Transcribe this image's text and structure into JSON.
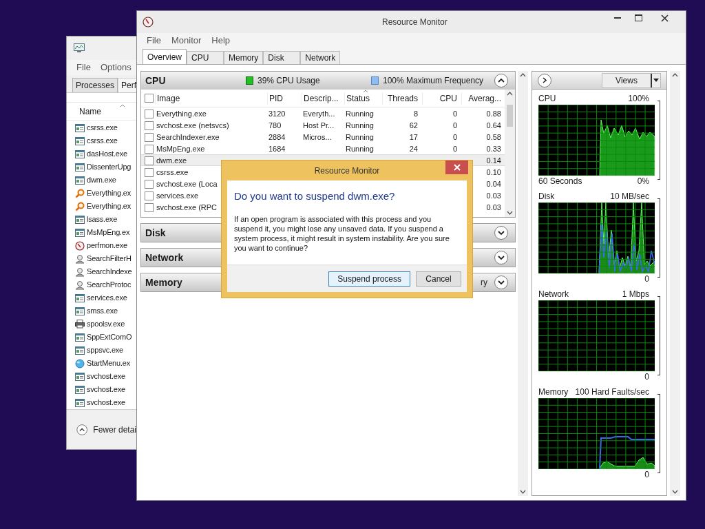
{
  "task_manager": {
    "menu": [
      "File",
      "Options"
    ],
    "tabs": [
      {
        "label": "Processes",
        "selected": true
      },
      {
        "label": "Perf",
        "selected": false
      }
    ],
    "column": "Name",
    "processes": [
      {
        "name": "csrss.exe",
        "kind": "app"
      },
      {
        "name": "csrss.exe",
        "kind": "app"
      },
      {
        "name": "dasHost.exe",
        "kind": "app"
      },
      {
        "name": "DissenterUpg",
        "kind": "app"
      },
      {
        "name": "dwm.exe",
        "kind": "app"
      },
      {
        "name": "Everything.ex",
        "kind": "search"
      },
      {
        "name": "Everything.ex",
        "kind": "search"
      },
      {
        "name": "lsass.exe",
        "kind": "app"
      },
      {
        "name": "MsMpEng.ex",
        "kind": "app"
      },
      {
        "name": "perfmon.exe",
        "kind": "gauge"
      },
      {
        "name": "SearchFilterH",
        "kind": "indexer"
      },
      {
        "name": "SearchIndexe",
        "kind": "indexer"
      },
      {
        "name": "SearchProtoc",
        "kind": "indexer"
      },
      {
        "name": "services.exe",
        "kind": "app"
      },
      {
        "name": "smss.exe",
        "kind": "app"
      },
      {
        "name": "spoolsv.exe",
        "kind": "printer"
      },
      {
        "name": "SppExtComO",
        "kind": "app"
      },
      {
        "name": "sppsvc.exe",
        "kind": "app"
      },
      {
        "name": "StartMenu.ex",
        "kind": "globe"
      },
      {
        "name": "svchost.exe",
        "kind": "app"
      },
      {
        "name": "svchost.exe",
        "kind": "app"
      },
      {
        "name": "svchost.exe",
        "kind": "app"
      }
    ],
    "footer": "Fewer detai"
  },
  "window": {
    "title": "Resource Monitor",
    "menu": [
      "File",
      "Monitor",
      "Help"
    ],
    "tabs": [
      {
        "label": "Overview",
        "selected": true
      },
      {
        "label": "CPU",
        "selected": false
      },
      {
        "label": "Memory",
        "selected": false
      },
      {
        "label": "Disk",
        "selected": false
      },
      {
        "label": "Network",
        "selected": false
      }
    ]
  },
  "cpu_section": {
    "title": "CPU",
    "expanded": true,
    "usage": "39% CPU Usage",
    "frequency": "100% Maximum Frequency",
    "select_all": {
      "checked": false
    },
    "columns": [
      "Image",
      "PID",
      "Descrip...",
      "Status",
      "Threads",
      "CPU",
      "Averag..."
    ],
    "rows": [
      {
        "checked": false,
        "selected": false,
        "image": "Everything.exe",
        "pid": "3120",
        "description": "Everyth...",
        "status": "Running",
        "threads": "8",
        "cpu": "0",
        "average": "0.88"
      },
      {
        "checked": false,
        "selected": false,
        "image": "svchost.exe (netsvcs)",
        "pid": "780",
        "description": "Host Pr...",
        "status": "Running",
        "threads": "62",
        "cpu": "0",
        "average": "0.64"
      },
      {
        "checked": false,
        "selected": false,
        "image": "SearchIndexer.exe",
        "pid": "2884",
        "description": "Micros...",
        "status": "Running",
        "threads": "17",
        "cpu": "0",
        "average": "0.58"
      },
      {
        "checked": false,
        "selected": false,
        "image": "MsMpEng.exe",
        "pid": "1684",
        "status": "Running",
        "threads": "24",
        "cpu": "0",
        "average": "0.33"
      },
      {
        "checked": false,
        "selected": true,
        "image": "dwm.exe",
        "average": "0.14"
      },
      {
        "checked": false,
        "selected": false,
        "image": "csrss.exe",
        "average": "0.10"
      },
      {
        "checked": false,
        "selected": false,
        "image": "svchost.exe (Loca",
        "average": "0.04"
      },
      {
        "checked": false,
        "selected": false,
        "image": "services.exe",
        "average": "0.03"
      },
      {
        "checked": false,
        "selected": false,
        "image": "svchost.exe (RPC",
        "average": "0.03"
      }
    ]
  },
  "sections": [
    {
      "title": "Disk",
      "expanded": false
    },
    {
      "title": "Network",
      "expanded": false
    },
    {
      "title": "Memory",
      "expanded": false,
      "summary": "ry"
    }
  ],
  "side_panel": {
    "views": "Views",
    "graphs": [
      {
        "kind": "cpu",
        "title": "CPU",
        "scale": "100%",
        "time": "60 Seconds",
        "floor": "0%"
      },
      {
        "kind": "disk",
        "title": "Disk",
        "scale": "10 MB/sec",
        "floor": "0"
      },
      {
        "kind": "network",
        "title": "Network",
        "scale": "1 Mbps",
        "floor": "0"
      },
      {
        "kind": "memory",
        "title": "Memory",
        "scale": "100 Hard Faults/sec",
        "floor": "0"
      }
    ]
  },
  "dialog": {
    "title": "Resource Monitor",
    "heading": "Do you want to suspend dwm.exe?",
    "message": "If an open program is associated with this process and you suspend it, you might lose any unsaved data. If you suspend a system process, it might result in system instability. Are you sure you want to continue?",
    "buttons": [
      {
        "label": "Suspend process",
        "selected": true
      },
      {
        "label": "Cancel",
        "selected": false
      }
    ]
  }
}
